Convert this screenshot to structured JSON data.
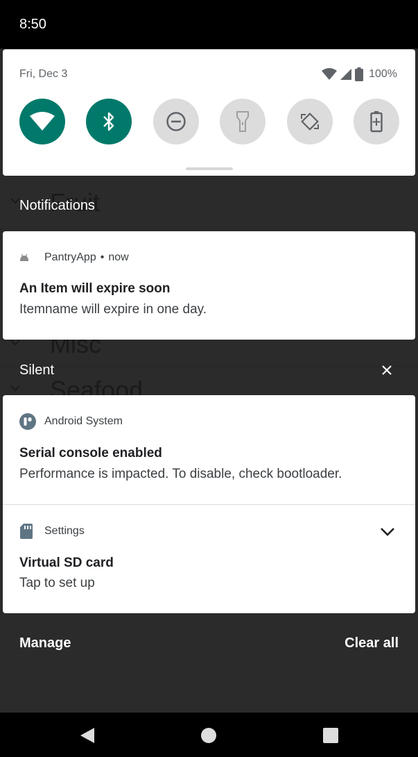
{
  "status_bar": {
    "time": "8:50"
  },
  "quick_settings": {
    "date": "Fri, Dec 3",
    "battery": "100%",
    "tiles": [
      {
        "name": "wifi",
        "active": true
      },
      {
        "name": "bluetooth",
        "active": true
      },
      {
        "name": "do-not-disturb",
        "active": false
      },
      {
        "name": "flashlight",
        "active": false
      },
      {
        "name": "auto-rotate",
        "active": false
      },
      {
        "name": "battery-saver",
        "active": false
      }
    ],
    "colors": {
      "active": "#00796b",
      "inactive": "#dcdcdc"
    }
  },
  "background_app": {
    "rows": [
      "Fruit",
      "Misc",
      "Seafood"
    ]
  },
  "sections": {
    "notifications": "Notifications",
    "silent": "Silent"
  },
  "notifications": [
    {
      "app": "PantryApp",
      "time": "now",
      "title": "An Item will expire soon",
      "text": "Itemname will expire in one day."
    }
  ],
  "silent_notifications": [
    {
      "app": "Android System",
      "title": "Serial console enabled",
      "text": "Performance is impacted. To disable, check bootloader."
    },
    {
      "app": "Settings",
      "title": "Virtual SD card",
      "text": "Tap to set up"
    }
  ],
  "footer": {
    "manage": "Manage",
    "clear_all": "Clear all"
  }
}
